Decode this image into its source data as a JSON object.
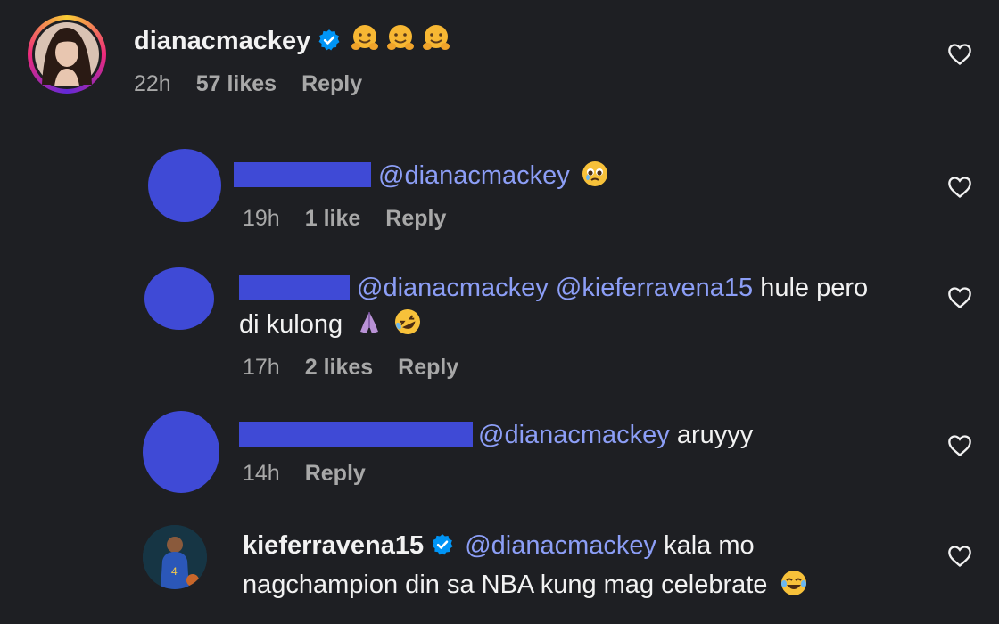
{
  "comments": [
    {
      "username": "dianacmackey",
      "text": "",
      "time": "22h",
      "likes": "57 likes",
      "reply": "Reply",
      "emoji": [
        "hugging-face-emoji",
        "hugging-face-emoji",
        "hugging-face-emoji"
      ]
    },
    {
      "mention": "@dianacmackey",
      "time": "19h",
      "likes": "1 like",
      "reply": "Reply",
      "emoji": [
        "pleading-face-emoji"
      ]
    },
    {
      "mention1": "@dianacmackey",
      "mention2": "@kieferravena15",
      "text1": " hule pero",
      "text2": "di kulong",
      "time": "17h",
      "likes": "2 likes",
      "reply": "Reply",
      "emoji": [
        "folded-hands-emoji",
        "rofl-emoji"
      ]
    },
    {
      "mention": "@dianacmackey",
      "text": " aruyyy",
      "time": "14h",
      "reply": "Reply"
    },
    {
      "username": "kieferravena15",
      "mention": "@dianacmackey",
      "text1": " kala mo",
      "text2": "nagchampion din sa NBA kung mag celebrate",
      "emoji": [
        "tears-of-joy-emoji"
      ]
    }
  ],
  "colors": {
    "background": "#1e1f23",
    "mention": "#8c9ef6",
    "verified": "#0095f6",
    "redaction": "#3f4ad6",
    "meta": "#a8a8a8"
  }
}
